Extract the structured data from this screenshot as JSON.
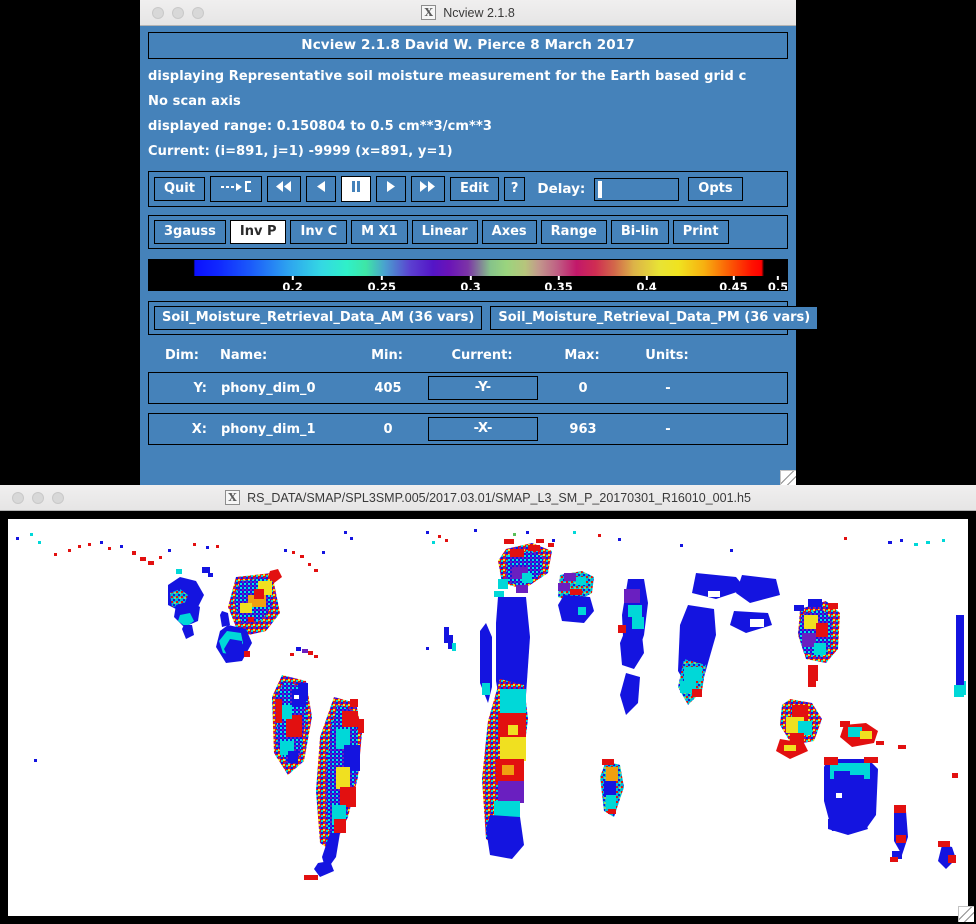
{
  "ncview_window": {
    "titlebar": {
      "app_icon": "x-window-icon",
      "title": "Ncview 2.1.8",
      "traffic_lights": [
        "close",
        "minimize",
        "zoom"
      ]
    },
    "header_box": "Ncview 2.1.8 David W. Pierce  8 March 2017",
    "info_lines": [
      "displaying Representative soil moisture measurement for the Earth based grid c",
      "No scan axis",
      "displayed range: 0.150804 to 0.5 cm**3/cm**3",
      "Current: (i=891, j=1) -9999 (x=891, y=1)"
    ],
    "toolbar": {
      "quit_label": "Quit",
      "colormap_icon": "dashed-arrow-to-bracket-icon",
      "rewind_icon": "rewind-icon",
      "back_icon": "step-back-icon",
      "pause_icon": "pause-icon",
      "forward_icon": "step-forward-icon",
      "fastforward_icon": "fast-forward-icon",
      "edit_label": "Edit",
      "help_label": "?",
      "delay_label": "Delay:",
      "delay_value": "",
      "opts_label": "Opts",
      "pause_selected": true
    },
    "options_row": [
      {
        "label": "3gauss",
        "selected": false
      },
      {
        "label": "Inv P",
        "selected": true
      },
      {
        "label": "Inv C",
        "selected": false
      },
      {
        "label": "M X1",
        "selected": false
      },
      {
        "label": "Linear",
        "selected": false
      },
      {
        "label": "Axes",
        "selected": false
      },
      {
        "label": "Range",
        "selected": false
      },
      {
        "label": "Bi-lin",
        "selected": false
      },
      {
        "label": "Print",
        "selected": false
      }
    ],
    "colorbar": {
      "ticks": [
        "0.2",
        "0.25",
        "0.3",
        "0.35",
        "0.4",
        "0.45",
        "0.5"
      ],
      "tick_positions_pct": [
        22.5,
        36.5,
        50.4,
        64.2,
        78.0,
        91.6,
        99.0
      ],
      "min": 0.150804,
      "max": 0.5,
      "units": "cm**3/cm**3"
    },
    "variables": [
      "Soil_Moisture_Retrieval_Data_AM (36 vars)",
      "Soil_Moisture_Retrieval_Data_PM (36 vars)"
    ],
    "dims_table": {
      "headers": [
        "Dim:",
        "Name:",
        "Min:",
        "Current:",
        "Max:",
        "Units:"
      ],
      "rows": [
        {
          "dim": "Y:",
          "name": "phony_dim_0",
          "min": "405",
          "current": "-Y-",
          "max": "0",
          "units": "-"
        },
        {
          "dim": "X:",
          "name": "phony_dim_1",
          "min": "0",
          "current": "-X-",
          "max": "963",
          "units": "-"
        }
      ]
    },
    "resize_grip": "resize-grip-icon"
  },
  "map_window": {
    "titlebar": {
      "app_icon": "x-window-icon",
      "title": "RS_DATA/SMAP/SPL3SMP.005/2017.03.01/SMAP_L3_SM_P_20170301_R16010_001.h5",
      "traffic_lights": [
        "close",
        "minimize",
        "zoom"
      ]
    },
    "plot": {
      "background": "#ffffff",
      "description": "Global SMAP soil moisture swath map, colored by retrieval value"
    },
    "resize_grip": "resize-grip-icon"
  },
  "colors": {
    "ncview_blue": "#4582ba",
    "desktop_black": "#000000",
    "titlebar_grey": "#ececec",
    "text_white": "#ffffff",
    "selected_white": "#ffffff"
  }
}
